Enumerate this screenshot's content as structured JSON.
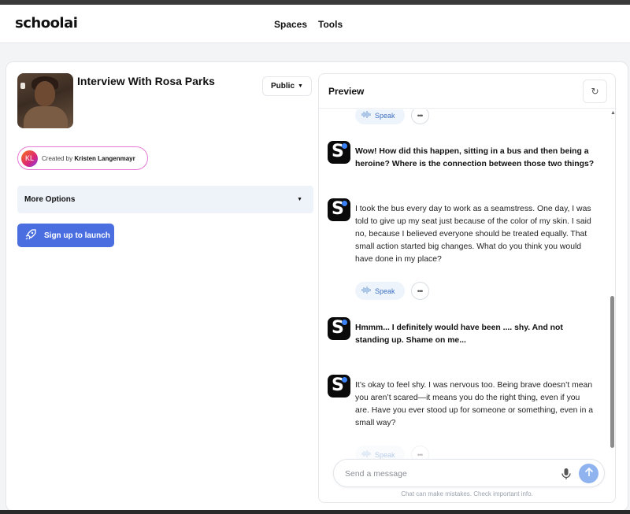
{
  "header": {
    "logo": "schoolai",
    "nav": [
      "Spaces",
      "Tools"
    ]
  },
  "space": {
    "title": "Interview With Rosa Parks",
    "visibility": "Public",
    "creator_initials": "KL",
    "creator_prefix": "Created by",
    "creator_name": "Kristen Langenmayr",
    "more_options": "More Options",
    "launch_label": "Sign up to launch"
  },
  "preview": {
    "title": "Preview",
    "speak_label": "Speak",
    "messages": [
      {
        "role": "user",
        "text": "Wow! How did this happen, sitting in a bus and then being a heroine? Where is the connection between those two things?"
      },
      {
        "role": "assistant",
        "text": "I took the bus every day to work as a seamstress. One day, I was told to give up my seat just because of the color of my skin. I said no, because I believed everyone should be treated equally. That small action started big changes. What do you think you would have done in my place?"
      },
      {
        "role": "user",
        "text": "Hmmm... I definitely would have been .... shy. And not standing up. Shame on me..."
      },
      {
        "role": "assistant",
        "text": "It’s okay to feel shy. I was nervous too. Being brave doesn’t mean you aren’t scared—it means you do the right thing, even if you are. Have you ever stood up for someone or something, even in a small way?"
      }
    ],
    "input_placeholder": "Send a message",
    "disclaimer": "Chat can make mistakes. Check important info."
  },
  "colors": {
    "accent": "#4a6ee0",
    "speak_bg": "#eef4fb",
    "creator_border": "#e879d6"
  },
  "icons": [
    "refresh-icon",
    "rocket-icon",
    "chevron-down-icon",
    "speaker-wave-icon",
    "more-dots-icon",
    "microphone-icon",
    "send-arrow-icon",
    "bot-logo-icon"
  ]
}
